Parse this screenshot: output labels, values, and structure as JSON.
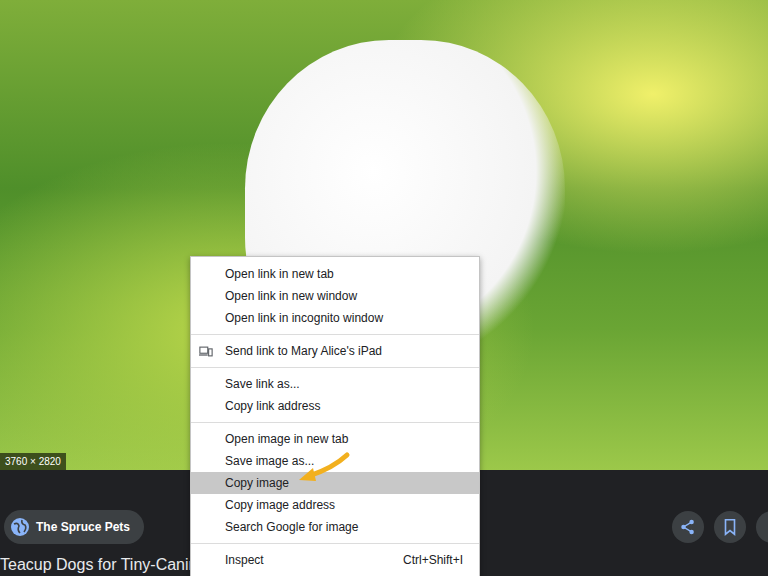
{
  "photo": {
    "dimensions": "3760 × 2820"
  },
  "source": {
    "name": "The Spruce Pets"
  },
  "result": {
    "title": "Teacup Dogs for Tiny-Canine Lovers"
  },
  "context_menu": {
    "groups": [
      [
        {
          "label": "Open link in new tab",
          "shortcut": "",
          "kind": "plain",
          "selected": false
        },
        {
          "label": "Open link in new window",
          "shortcut": "",
          "kind": "plain",
          "selected": false
        },
        {
          "label": "Open link in incognito window",
          "shortcut": "",
          "kind": "plain",
          "selected": false
        }
      ],
      [
        {
          "label": "Send link to Mary Alice's iPad",
          "shortcut": "",
          "kind": "device",
          "selected": false
        }
      ],
      [
        {
          "label": "Save link as...",
          "shortcut": "",
          "kind": "plain",
          "selected": false
        },
        {
          "label": "Copy link address",
          "shortcut": "",
          "kind": "plain",
          "selected": false
        }
      ],
      [
        {
          "label": "Open image in new tab",
          "shortcut": "",
          "kind": "plain",
          "selected": false
        },
        {
          "label": "Save image as...",
          "shortcut": "",
          "kind": "plain",
          "selected": false
        },
        {
          "label": "Copy image",
          "shortcut": "",
          "kind": "plain",
          "selected": true
        },
        {
          "label": "Copy image address",
          "shortcut": "",
          "kind": "plain",
          "selected": false
        },
        {
          "label": "Search Google for image",
          "shortcut": "",
          "kind": "plain",
          "selected": false
        }
      ],
      [
        {
          "label": "Inspect",
          "shortcut": "Ctrl+Shift+I",
          "kind": "plain",
          "selected": false
        }
      ]
    ]
  }
}
